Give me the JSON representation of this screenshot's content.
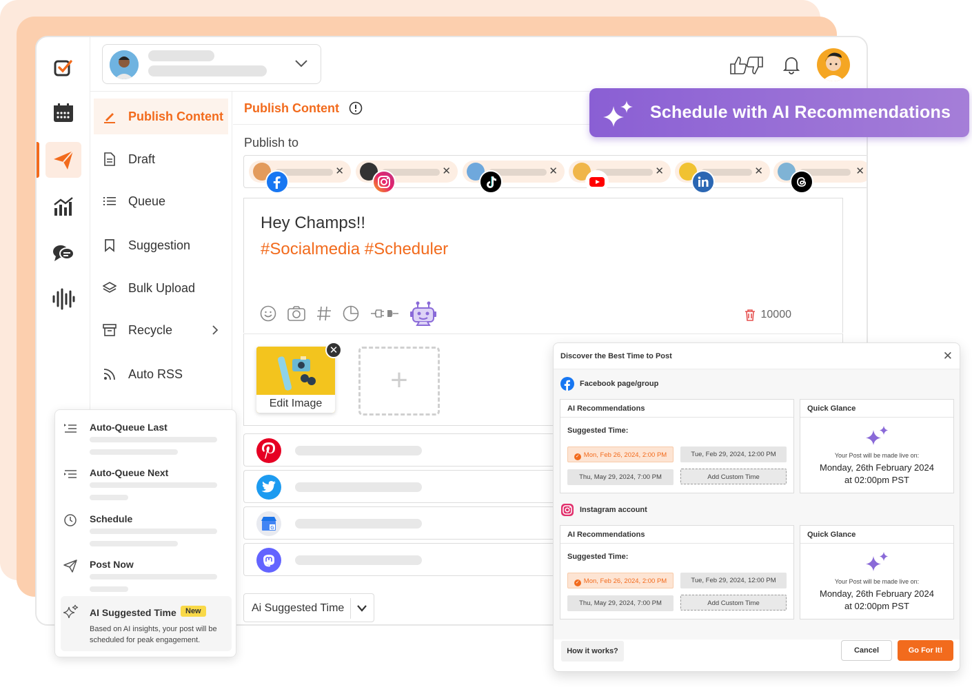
{
  "brand": {
    "accent": "#f26b1d",
    "purple": "#8a5fd4"
  },
  "rail": {
    "icons": [
      "logo-check-icon",
      "calendar-icon",
      "send-icon",
      "analytics-icon",
      "chat-icon",
      "audio-wave-icon"
    ],
    "active": "send-icon"
  },
  "header": {
    "actions": [
      "thumbs-up-down-icon",
      "bell-icon",
      "user-avatar"
    ]
  },
  "subnav": {
    "items": [
      {
        "label": "Publish Content",
        "icon": "pencil-icon",
        "active": true
      },
      {
        "label": "Draft",
        "icon": "document-icon"
      },
      {
        "label": "Queue",
        "icon": "list-icon"
      },
      {
        "label": "Suggestion",
        "icon": "bookmark-icon"
      },
      {
        "label": "Bulk Upload",
        "icon": "layers-icon"
      },
      {
        "label": "Recycle",
        "icon": "archive-icon"
      },
      {
        "label": "Auto RSS",
        "icon": "rss-icon"
      }
    ]
  },
  "main": {
    "title": "Publish Content",
    "publish_to_label": "Publish to",
    "accounts": [
      "facebook",
      "instagram",
      "tiktok",
      "youtube",
      "linkedin",
      "threads"
    ],
    "editor": {
      "line1": "Hey Champs!!",
      "line2": "#Socialmedia #Scheduler",
      "tools": [
        "emoji-icon",
        "camera-icon",
        "hashtag-icon",
        "pie-chart-icon",
        "plug-icon",
        "robot-icon"
      ],
      "char_count": "10000"
    },
    "media": {
      "edit_label": "Edit Image",
      "add_label": "+"
    },
    "networks": [
      "pinterest",
      "twitter",
      "google-business",
      "mastodon"
    ],
    "time_select_label": "Ai Suggested Time"
  },
  "banner": {
    "label": "Schedule with AI Recommendations"
  },
  "popover": {
    "items": [
      {
        "title": "Auto-Queue Last",
        "icon": "queue-last-icon"
      },
      {
        "title": "Auto-Queue Next",
        "icon": "queue-next-icon"
      },
      {
        "title": "Schedule",
        "icon": "clock-icon"
      },
      {
        "title": "Post Now",
        "icon": "paper-plane-icon"
      }
    ],
    "ai": {
      "title": "AI Suggested Time",
      "badge": "New",
      "desc": "Based on AI insights, your post will be scheduled for peak engagement."
    }
  },
  "modal": {
    "title": "Discover the Best Time to Post",
    "sections": [
      {
        "account": "Facebook page/group",
        "rec_title": "AI Recommendations",
        "suggested_label": "Suggested Time:",
        "times": [
          "Mon, Feb 26, 2024, 2:00 PM",
          "Tue, Feb 29, 2024, 12:00 PM",
          "Thu, May 29, 2024, 7:00 PM"
        ],
        "custom_label": "Add Custom Time",
        "glance_title": "Quick Glance",
        "live_text": "Your Post will be made live on:",
        "date_line1": "Monday, 26th February 2024",
        "date_line2": "at 02:00pm PST"
      },
      {
        "account": "Instagram account",
        "rec_title": "AI Recommendations",
        "suggested_label": "Suggested Time:",
        "times": [
          "Mon, Feb 26, 2024, 2:00 PM",
          "Tue, Feb 29, 2024, 12:00 PM",
          "Thu, May 29, 2024, 7:00 PM"
        ],
        "custom_label": "Add Custom Time",
        "glance_title": "Quick Glance",
        "live_text": "Your Post will be made live on:",
        "date_line1": "Monday, 26th February 2024",
        "date_line2": "at 02:00pm PST"
      }
    ],
    "how_label": "How it works?",
    "cancel_label": "Cancel",
    "go_label": "Go For It!"
  }
}
